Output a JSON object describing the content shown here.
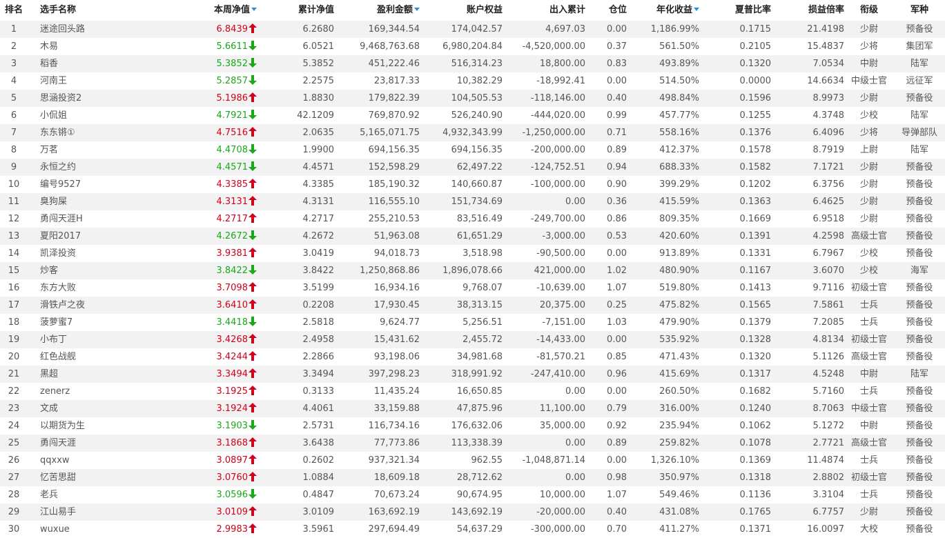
{
  "header": {
    "rank": "排名",
    "name": "选手名称",
    "nav": "本周净值",
    "cum_nav": "累计净值",
    "profit": "盈利金额",
    "equity": "账户权益",
    "flow": "出入累计",
    "position": "仓位",
    "annual": "年化收益",
    "sharpe": "夏普比率",
    "pl_ratio": "损益倍率",
    "rank_title": "衔级",
    "branch": "军种"
  },
  "colors": {
    "up": "#d0021b",
    "down": "#1aa71a",
    "sort": "#2a8fd6",
    "stripe": "#f2f2f2"
  },
  "rows": [
    {
      "rank": "1",
      "name": "迷途回头路",
      "nav": "6.8439",
      "dir": "up",
      "cum": "6.2680",
      "profit": "169,344.54",
      "equity": "174,042.57",
      "flow": "4,697.03",
      "pos": "0.00",
      "annual": "1,186.99%",
      "sharpe": "0.1715",
      "pl": "21.4198",
      "title": "少尉",
      "branch": "预备役"
    },
    {
      "rank": "2",
      "name": "木易",
      "nav": "5.6611",
      "dir": "down",
      "cum": "6.0521",
      "profit": "9,468,763.68",
      "equity": "6,980,204.84",
      "flow": "-4,520,000.00",
      "pos": "0.37",
      "annual": "561.50%",
      "sharpe": "0.2105",
      "pl": "15.4837",
      "title": "少将",
      "branch": "集团军"
    },
    {
      "rank": "3",
      "name": "稻香",
      "nav": "5.3852",
      "dir": "down",
      "cum": "5.3852",
      "profit": "451,222.46",
      "equity": "516,314.23",
      "flow": "18,800.00",
      "pos": "0.83",
      "annual": "493.89%",
      "sharpe": "0.1320",
      "pl": "7.0534",
      "title": "中尉",
      "branch": "陆军"
    },
    {
      "rank": "4",
      "name": "河南王",
      "nav": "5.2857",
      "dir": "down",
      "cum": "2.2575",
      "profit": "23,817.33",
      "equity": "10,382.29",
      "flow": "-18,992.41",
      "pos": "0.00",
      "annual": "514.50%",
      "sharpe": "0.0000",
      "pl": "14.6634",
      "title": "中级士官",
      "branch": "远征军"
    },
    {
      "rank": "5",
      "name": "思涵投资2",
      "nav": "5.1986",
      "dir": "up",
      "cum": "1.8830",
      "profit": "179,822.39",
      "equity": "104,505.53",
      "flow": "-118,146.00",
      "pos": "0.40",
      "annual": "498.84%",
      "sharpe": "0.1596",
      "pl": "8.9973",
      "title": "少尉",
      "branch": "预备役"
    },
    {
      "rank": "6",
      "name": "小侃姐",
      "nav": "4.7921",
      "dir": "down",
      "cum": "42.1209",
      "profit": "769,870.92",
      "equity": "526,240.90",
      "flow": "-444,020.00",
      "pos": "0.99",
      "annual": "457.77%",
      "sharpe": "0.1255",
      "pl": "4.3748",
      "title": "少校",
      "branch": "陆军"
    },
    {
      "rank": "7",
      "name": "东东锵①",
      "nav": "4.7516",
      "dir": "up",
      "cum": "2.0635",
      "profit": "5,165,071.75",
      "equity": "4,932,343.99",
      "flow": "-1,250,000.00",
      "pos": "0.71",
      "annual": "558.16%",
      "sharpe": "0.1376",
      "pl": "6.4096",
      "title": "少将",
      "branch": "导弹部队"
    },
    {
      "rank": "8",
      "name": "万茗",
      "nav": "4.4708",
      "dir": "down",
      "cum": "1.9900",
      "profit": "694,156.35",
      "equity": "694,156.35",
      "flow": "-200,000.00",
      "pos": "0.89",
      "annual": "412.37%",
      "sharpe": "0.1578",
      "pl": "8.7919",
      "title": "上尉",
      "branch": "陆军"
    },
    {
      "rank": "9",
      "name": "永恒之约",
      "nav": "4.4571",
      "dir": "down",
      "cum": "4.4571",
      "profit": "152,598.29",
      "equity": "62,497.22",
      "flow": "-124,752.51",
      "pos": "0.94",
      "annual": "688.33%",
      "sharpe": "0.1582",
      "pl": "7.1721",
      "title": "少尉",
      "branch": "预备役"
    },
    {
      "rank": "10",
      "name": "编号9527",
      "nav": "4.3385",
      "dir": "up",
      "cum": "4.3385",
      "profit": "185,190.32",
      "equity": "140,660.87",
      "flow": "-100,000.00",
      "pos": "0.90",
      "annual": "399.29%",
      "sharpe": "0.1202",
      "pl": "6.3756",
      "title": "少尉",
      "branch": "预备役"
    },
    {
      "rank": "11",
      "name": "臭狗屎",
      "nav": "4.3131",
      "dir": "up",
      "cum": "4.3131",
      "profit": "116,555.10",
      "equity": "151,734.69",
      "flow": "0.00",
      "pos": "0.36",
      "annual": "415.59%",
      "sharpe": "0.1363",
      "pl": "6.4625",
      "title": "少尉",
      "branch": "预备役"
    },
    {
      "rank": "12",
      "name": "勇闯天涯H",
      "nav": "4.2717",
      "dir": "up",
      "cum": "4.2717",
      "profit": "255,210.53",
      "equity": "83,516.49",
      "flow": "-249,700.00",
      "pos": "0.86",
      "annual": "809.35%",
      "sharpe": "0.1669",
      "pl": "6.9518",
      "title": "少尉",
      "branch": "预备役"
    },
    {
      "rank": "13",
      "name": "夏阳2017",
      "nav": "4.2672",
      "dir": "down",
      "cum": "4.2672",
      "profit": "51,963.08",
      "equity": "61,651.29",
      "flow": "-3,000.00",
      "pos": "0.53",
      "annual": "420.60%",
      "sharpe": "0.1391",
      "pl": "4.2598",
      "title": "高级士官",
      "branch": "预备役"
    },
    {
      "rank": "14",
      "name": "凯泽投资",
      "nav": "3.9381",
      "dir": "up",
      "cum": "3.0419",
      "profit": "94,018.73",
      "equity": "3,518.98",
      "flow": "-90,500.00",
      "pos": "0.00",
      "annual": "913.89%",
      "sharpe": "0.1331",
      "pl": "6.7967",
      "title": "少校",
      "branch": "预备役"
    },
    {
      "rank": "15",
      "name": "炒客",
      "nav": "3.8422",
      "dir": "down",
      "cum": "3.8422",
      "profit": "1,250,868.86",
      "equity": "1,896,078.66",
      "flow": "421,000.00",
      "pos": "1.02",
      "annual": "480.90%",
      "sharpe": "0.1167",
      "pl": "3.6070",
      "title": "少校",
      "branch": "海军"
    },
    {
      "rank": "16",
      "name": "东方大败",
      "nav": "3.7098",
      "dir": "up",
      "cum": "3.5199",
      "profit": "16,934.16",
      "equity": "9,768.07",
      "flow": "-10,639.00",
      "pos": "1.07",
      "annual": "519.80%",
      "sharpe": "0.1413",
      "pl": "9.7116",
      "title": "初级士官",
      "branch": "预备役"
    },
    {
      "rank": "17",
      "name": "滑铁卢之夜",
      "nav": "3.6410",
      "dir": "up",
      "cum": "0.2208",
      "profit": "17,930.45",
      "equity": "38,313.15",
      "flow": "20,375.00",
      "pos": "0.25",
      "annual": "475.82%",
      "sharpe": "0.1565",
      "pl": "7.5861",
      "title": "士兵",
      "branch": "预备役"
    },
    {
      "rank": "18",
      "name": "菠萝蜜7",
      "nav": "3.4418",
      "dir": "down",
      "cum": "2.5818",
      "profit": "9,624.77",
      "equity": "5,256.51",
      "flow": "-7,151.00",
      "pos": "1.03",
      "annual": "479.90%",
      "sharpe": "0.1379",
      "pl": "7.2085",
      "title": "士兵",
      "branch": "预备役"
    },
    {
      "rank": "19",
      "name": "小布丁",
      "nav": "3.4268",
      "dir": "up",
      "cum": "2.4958",
      "profit": "15,431.62",
      "equity": "2,455.72",
      "flow": "-14,433.00",
      "pos": "0.00",
      "annual": "535.92%",
      "sharpe": "0.1328",
      "pl": "4.8134",
      "title": "初级士官",
      "branch": "预备役"
    },
    {
      "rank": "20",
      "name": "红色战舰",
      "nav": "3.4244",
      "dir": "up",
      "cum": "2.2866",
      "profit": "93,198.06",
      "equity": "34,981.68",
      "flow": "-81,570.21",
      "pos": "0.85",
      "annual": "471.43%",
      "sharpe": "0.1320",
      "pl": "5.1126",
      "title": "高级士官",
      "branch": "预备役"
    },
    {
      "rank": "21",
      "name": "黑超",
      "nav": "3.3494",
      "dir": "up",
      "cum": "3.3494",
      "profit": "397,298.23",
      "equity": "318,991.92",
      "flow": "-247,410.00",
      "pos": "0.96",
      "annual": "415.69%",
      "sharpe": "0.1317",
      "pl": "4.5248",
      "title": "中尉",
      "branch": "陆军"
    },
    {
      "rank": "22",
      "name": "zenerz",
      "nav": "3.1925",
      "dir": "up",
      "cum": "0.3133",
      "profit": "11,435.24",
      "equity": "16,650.85",
      "flow": "0.00",
      "pos": "0.00",
      "annual": "260.50%",
      "sharpe": "0.1682",
      "pl": "5.7160",
      "title": "士兵",
      "branch": "预备役"
    },
    {
      "rank": "23",
      "name": "文成",
      "nav": "3.1924",
      "dir": "up",
      "cum": "4.4061",
      "profit": "33,159.88",
      "equity": "47,875.96",
      "flow": "11,100.00",
      "pos": "0.79",
      "annual": "316.00%",
      "sharpe": "0.1240",
      "pl": "8.7063",
      "title": "中级士官",
      "branch": "预备役"
    },
    {
      "rank": "24",
      "name": "以期货为生",
      "nav": "3.1903",
      "dir": "down",
      "cum": "2.5731",
      "profit": "116,734.16",
      "equity": "176,632.06",
      "flow": "35,000.00",
      "pos": "0.92",
      "annual": "235.94%",
      "sharpe": "0.1062",
      "pl": "5.1272",
      "title": "中尉",
      "branch": "预备役"
    },
    {
      "rank": "25",
      "name": "勇闯天涯",
      "nav": "3.1868",
      "dir": "up",
      "cum": "3.6438",
      "profit": "77,773.86",
      "equity": "113,338.39",
      "flow": "0.00",
      "pos": "0.89",
      "annual": "259.82%",
      "sharpe": "0.1078",
      "pl": "2.7721",
      "title": "高级士官",
      "branch": "预备役"
    },
    {
      "rank": "26",
      "name": "qqxxw",
      "nav": "3.0897",
      "dir": "up",
      "cum": "0.2602",
      "profit": "937,321.34",
      "equity": "962.55",
      "flow": "-1,048,871.14",
      "pos": "0.00",
      "annual": "1,326.10%",
      "sharpe": "0.1369",
      "pl": "11.4874",
      "title": "士兵",
      "branch": "预备役"
    },
    {
      "rank": "27",
      "name": "忆苦思甜",
      "nav": "3.0760",
      "dir": "up",
      "cum": "1.0884",
      "profit": "18,609.18",
      "equity": "28,712.62",
      "flow": "0.00",
      "pos": "0.98",
      "annual": "350.97%",
      "sharpe": "0.1318",
      "pl": "2.8802",
      "title": "初级士官",
      "branch": "预备役"
    },
    {
      "rank": "28",
      "name": "老兵",
      "nav": "3.0596",
      "dir": "down",
      "cum": "0.4847",
      "profit": "70,673.24",
      "equity": "90,674.95",
      "flow": "10,000.00",
      "pos": "1.07",
      "annual": "549.46%",
      "sharpe": "0.1136",
      "pl": "3.3104",
      "title": "士兵",
      "branch": "预备役"
    },
    {
      "rank": "29",
      "name": "江山易手",
      "nav": "3.0109",
      "dir": "up",
      "cum": "3.0109",
      "profit": "163,692.19",
      "equity": "143,692.19",
      "flow": "-20,000.00",
      "pos": "0.40",
      "annual": "431.08%",
      "sharpe": "0.1765",
      "pl": "6.7757",
      "title": "少尉",
      "branch": "预备役"
    },
    {
      "rank": "30",
      "name": "wuxue",
      "nav": "2.9983",
      "dir": "up",
      "cum": "3.5961",
      "profit": "297,694.49",
      "equity": "54,637.29",
      "flow": "-300,000.00",
      "pos": "0.70",
      "annual": "411.27%",
      "sharpe": "0.1371",
      "pl": "16.0097",
      "title": "大校",
      "branch": "预备役"
    }
  ]
}
